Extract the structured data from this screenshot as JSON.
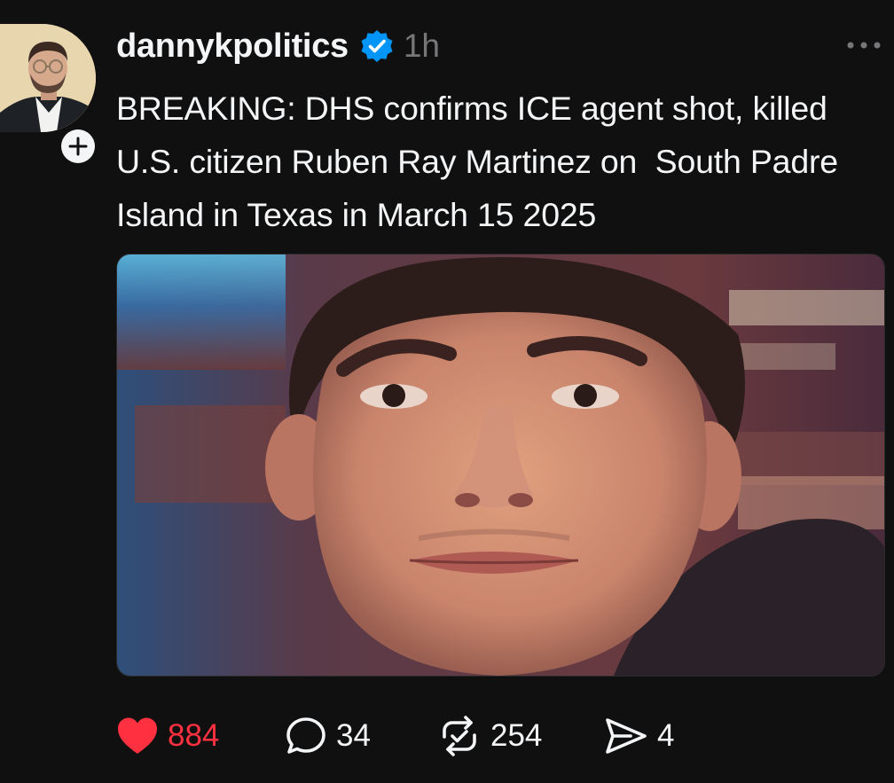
{
  "post": {
    "username": "dannykpolitics",
    "verified": true,
    "timestamp": "1h",
    "text": "BREAKING: DHS confirms ICE agent shot, killed U.S. citizen Ruben Ray Martinez on  South Padre Island in Texas in March 15 2025",
    "image_alt": "Photo of a young man",
    "actions": {
      "likes": "884",
      "replies": "34",
      "reposts": "254",
      "shares": "4"
    }
  },
  "colors": {
    "background": "#101010",
    "text": "#f3f5f7",
    "muted": "#77777a",
    "like": "#ff3040",
    "verified": "#0095f6"
  },
  "icons": {
    "follow": "plus-icon",
    "verified": "verified-badge-icon",
    "more": "more-horizontal-icon",
    "like": "heart-icon",
    "reply": "comment-bubble-icon",
    "repost": "repost-icon",
    "share": "send-icon"
  }
}
